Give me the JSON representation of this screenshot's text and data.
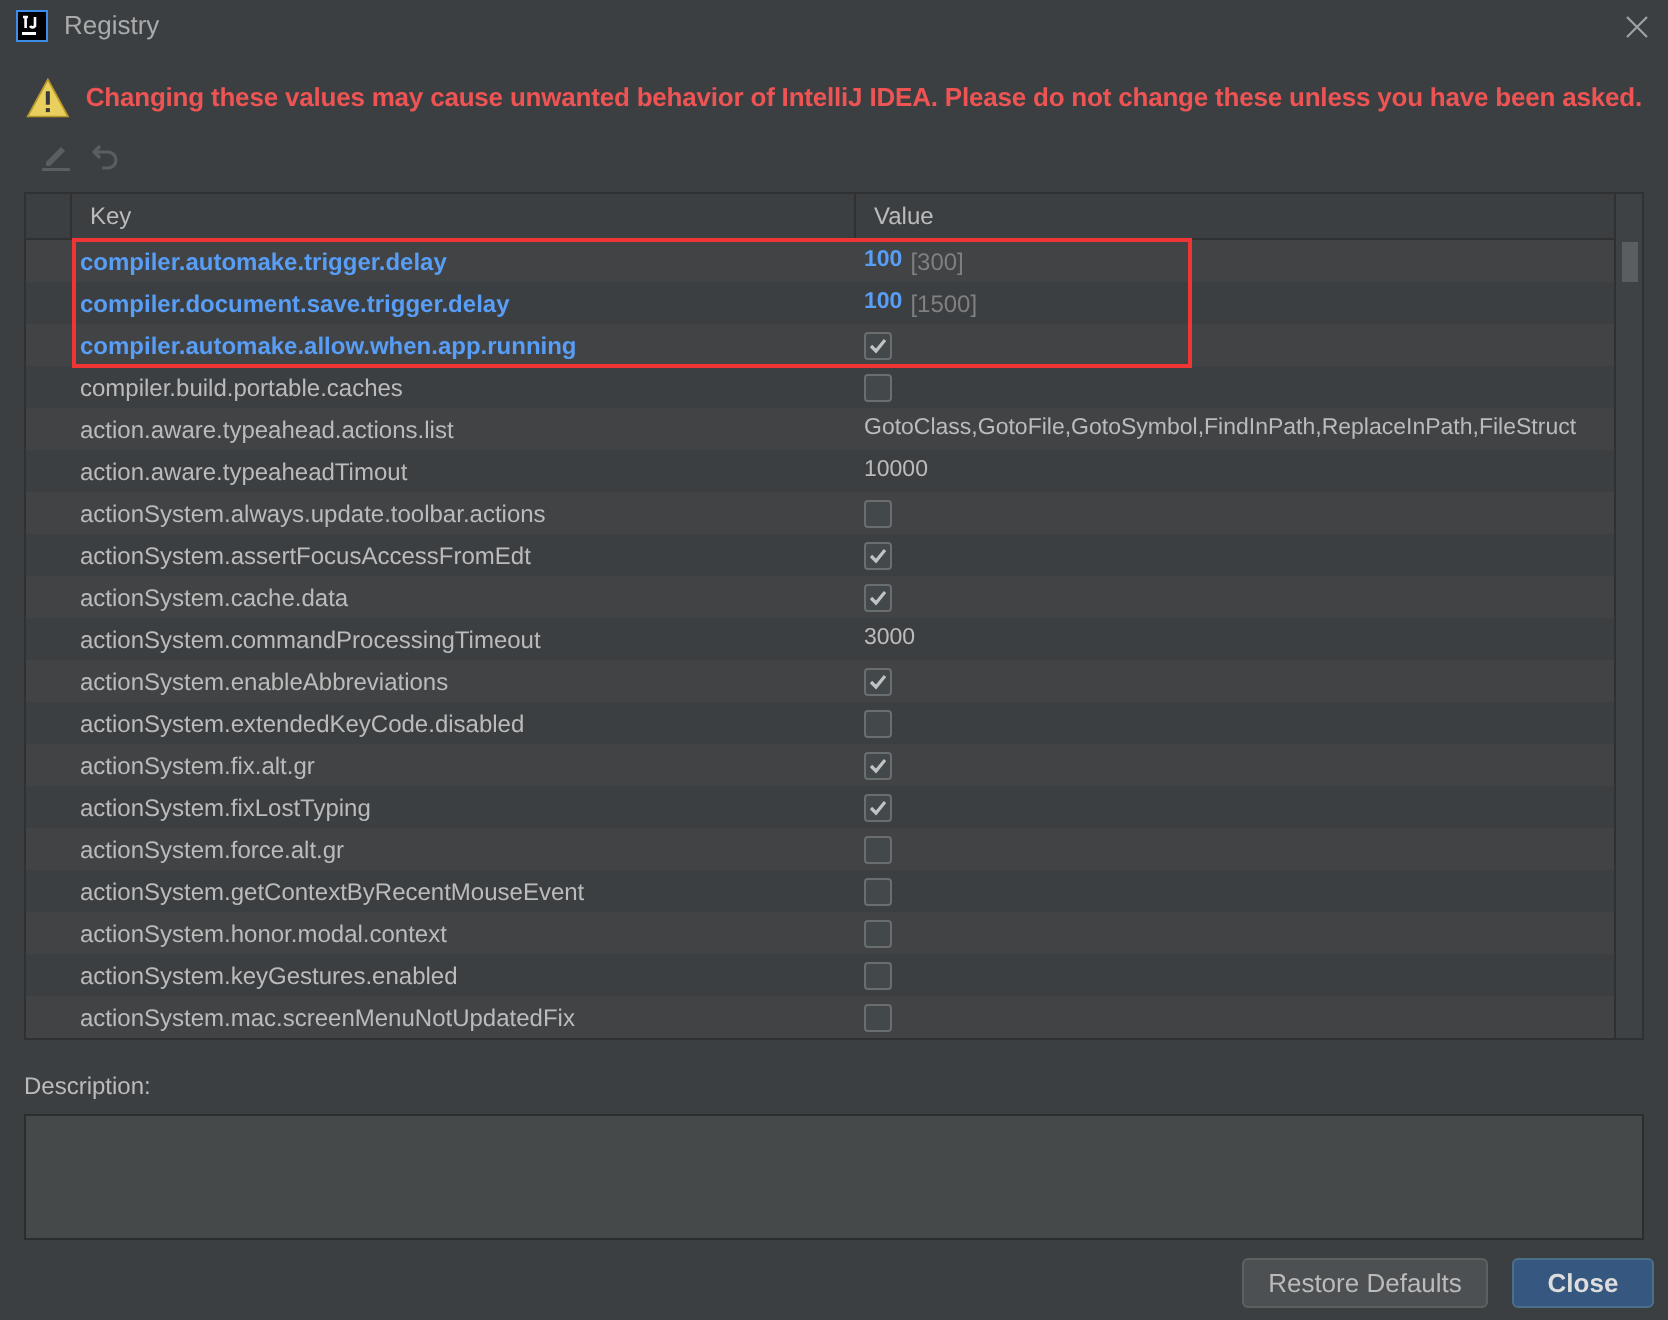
{
  "window": {
    "title": "Registry"
  },
  "warning": "Changing these values may cause unwanted behavior of IntelliJ IDEA. Please do not change these unless you have been asked.",
  "toolbar": [
    {
      "kind": "edit",
      "disabled": true
    },
    {
      "kind": "revert",
      "disabled": true
    }
  ],
  "table": {
    "columns": [
      "Key",
      "Value"
    ],
    "rows": [
      {
        "key": "compiler.automake.trigger.delay",
        "kind": "text",
        "value": "100",
        "default": "[300]",
        "modified": true,
        "highlighted": true
      },
      {
        "key": "compiler.document.save.trigger.delay",
        "kind": "text",
        "value": "100",
        "default": "[1500]",
        "modified": true,
        "highlighted": true
      },
      {
        "key": "compiler.automake.allow.when.app.running",
        "kind": "checkbox",
        "checked": true,
        "modified": true,
        "highlighted": true
      },
      {
        "key": "compiler.build.portable.caches",
        "kind": "checkbox",
        "checked": false,
        "modified": false,
        "highlighted": false
      },
      {
        "key": "action.aware.typeahead.actions.list",
        "kind": "text",
        "value": "GotoClass,GotoFile,GotoSymbol,FindInPath,ReplaceInPath,FileStruct",
        "modified": false,
        "highlighted": false
      },
      {
        "key": "action.aware.typeaheadTimout",
        "kind": "text",
        "value": "10000",
        "modified": false,
        "highlighted": false
      },
      {
        "key": "actionSystem.always.update.toolbar.actions",
        "kind": "checkbox",
        "checked": false,
        "modified": false,
        "highlighted": false
      },
      {
        "key": "actionSystem.assertFocusAccessFromEdt",
        "kind": "checkbox",
        "checked": true,
        "modified": false,
        "highlighted": false
      },
      {
        "key": "actionSystem.cache.data",
        "kind": "checkbox",
        "checked": true,
        "modified": false,
        "highlighted": false
      },
      {
        "key": "actionSystem.commandProcessingTimeout",
        "kind": "text",
        "value": "3000",
        "modified": false,
        "highlighted": false
      },
      {
        "key": "actionSystem.enableAbbreviations",
        "kind": "checkbox",
        "checked": true,
        "modified": false,
        "highlighted": false
      },
      {
        "key": "actionSystem.extendedKeyCode.disabled",
        "kind": "checkbox",
        "checked": false,
        "modified": false,
        "highlighted": false
      },
      {
        "key": "actionSystem.fix.alt.gr",
        "kind": "checkbox",
        "checked": true,
        "modified": false,
        "highlighted": false
      },
      {
        "key": "actionSystem.fixLostTyping",
        "kind": "checkbox",
        "checked": true,
        "modified": false,
        "highlighted": false
      },
      {
        "key": "actionSystem.force.alt.gr",
        "kind": "checkbox",
        "checked": false,
        "modified": false,
        "highlighted": false
      },
      {
        "key": "actionSystem.getContextByRecentMouseEvent",
        "kind": "checkbox",
        "checked": false,
        "modified": false,
        "highlighted": false
      },
      {
        "key": "actionSystem.honor.modal.context",
        "kind": "checkbox",
        "checked": false,
        "modified": false,
        "highlighted": false
      },
      {
        "key": "actionSystem.keyGestures.enabled",
        "kind": "checkbox",
        "checked": false,
        "modified": false,
        "highlighted": false
      },
      {
        "key": "actionSystem.mac.screenMenuNotUpdatedFix",
        "kind": "checkbox",
        "checked": false,
        "modified": false,
        "highlighted": false
      }
    ]
  },
  "description": {
    "label": "Description:"
  },
  "buttons": [
    {
      "label": "Restore Defaults",
      "kind": "secondary"
    },
    {
      "label": "Close",
      "kind": "primary"
    }
  ]
}
